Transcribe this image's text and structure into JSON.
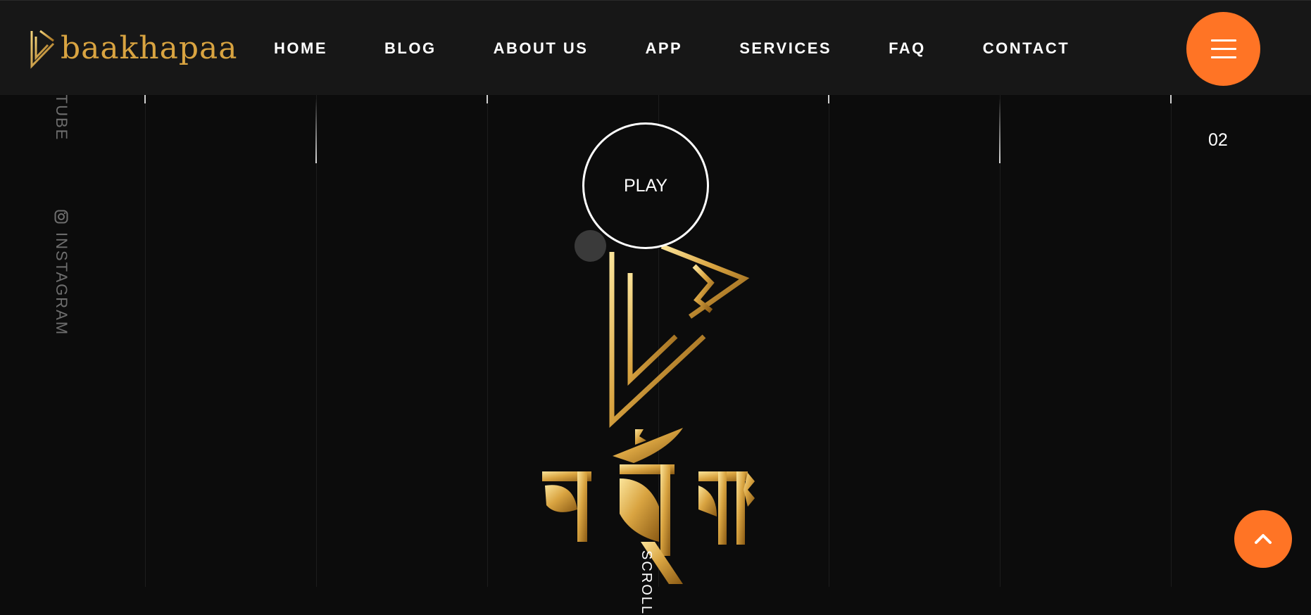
{
  "brand": {
    "name": "baakhapaa"
  },
  "nav": {
    "items": [
      {
        "label": "HOME"
      },
      {
        "label": "BLOG"
      },
      {
        "label": "ABOUT US"
      },
      {
        "label": "APP"
      },
      {
        "label": "SERVICES"
      },
      {
        "label": "FAQ"
      },
      {
        "label": "CONTACT"
      }
    ]
  },
  "menu_button": {
    "icon": "hamburger-icon"
  },
  "social": {
    "youtube_label": "YOUTUBE",
    "instagram_label": "INSTAGRAM",
    "instagram_icon": "instagram-icon"
  },
  "slider": {
    "counter": "02"
  },
  "hero": {
    "play_label": "PLAY",
    "scroll_label": "SCROLL"
  },
  "back_to_top": {
    "icon": "chevron-up-icon"
  },
  "colors": {
    "accent": "#ff7425",
    "gold": "#d9a441",
    "background": "#0c0c0c",
    "header": "#171717"
  }
}
